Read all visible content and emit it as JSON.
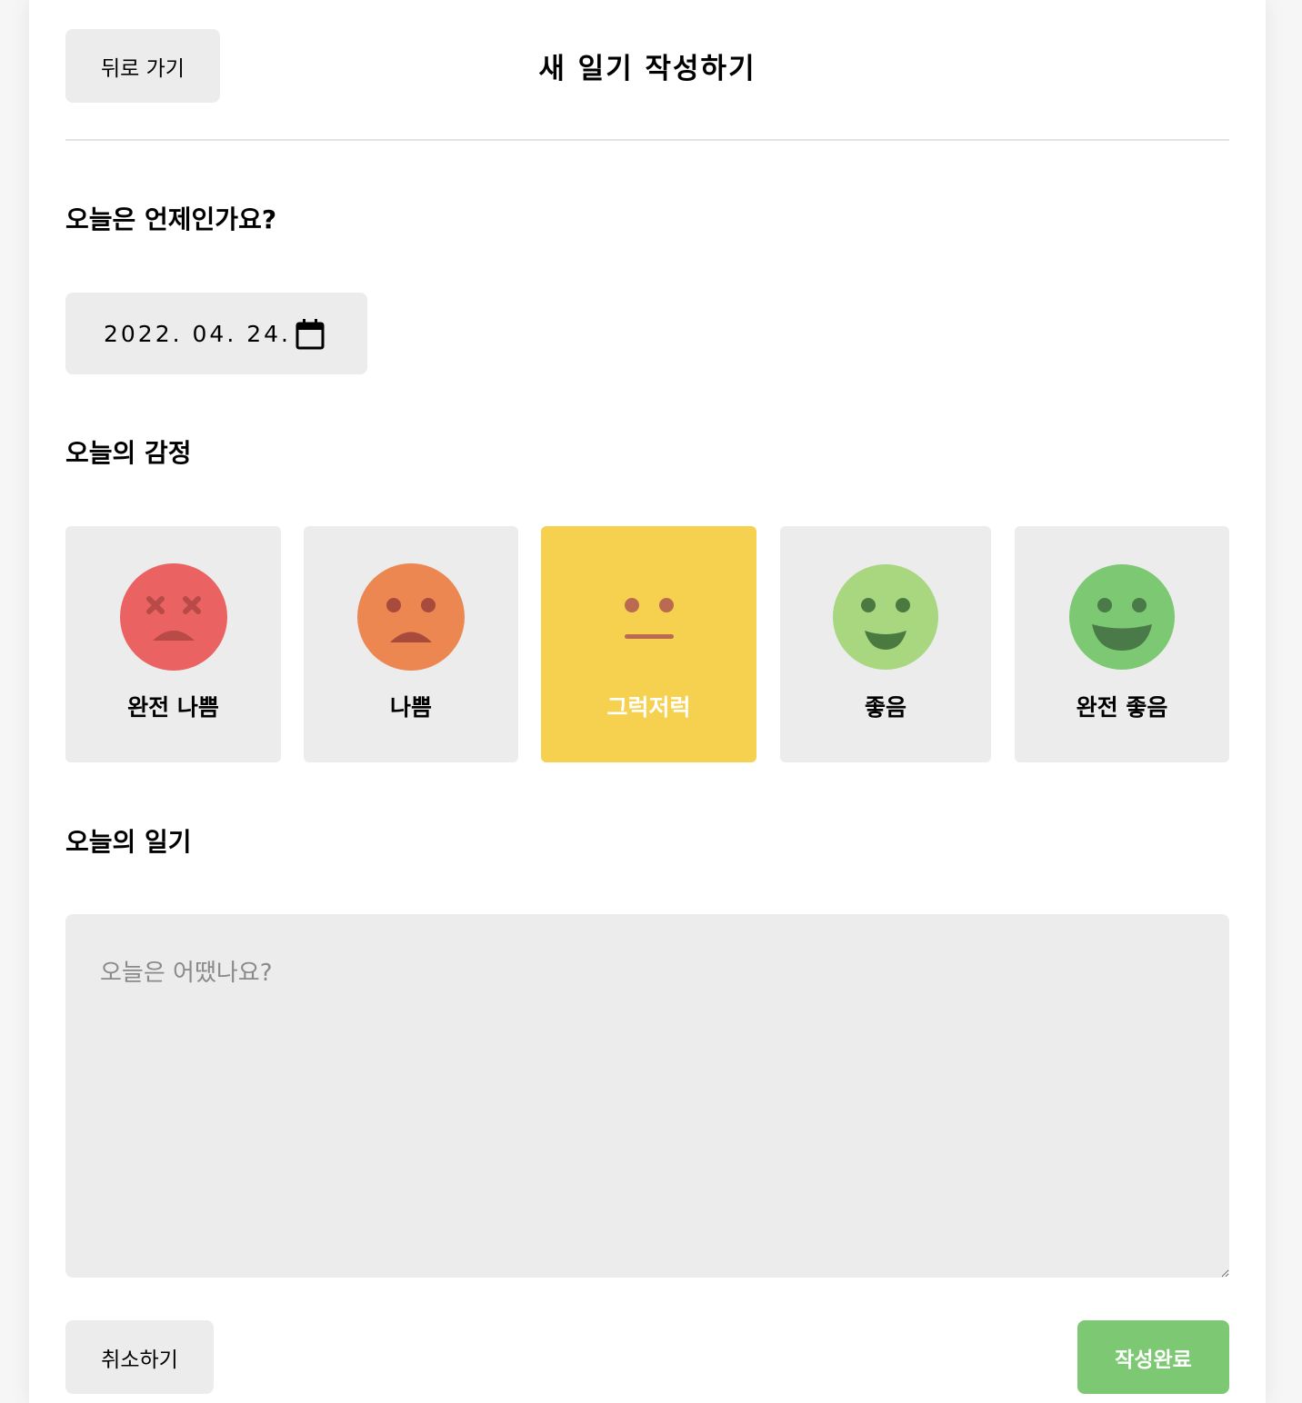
{
  "header": {
    "back_label": "뒤로 가기",
    "title": "새 일기 작성하기"
  },
  "date_section": {
    "title": "오늘은 언제인가요?",
    "value": "2022. 04. 24.",
    "icon": "calendar-icon"
  },
  "emotion_section": {
    "title": "오늘의 감정",
    "items": [
      {
        "label": "완전 나쁨",
        "color": "#ea6262",
        "feature": "#b84a48",
        "selected": false,
        "icon": "very-bad-face-icon"
      },
      {
        "label": "나쁨",
        "color": "#ec8752",
        "feature": "#a84a3c",
        "selected": false,
        "icon": "bad-face-icon"
      },
      {
        "label": "그럭저럭",
        "color": "#f5d14f",
        "feature": "#b96a50",
        "selected": true,
        "icon": "neutral-face-icon"
      },
      {
        "label": "좋음",
        "color": "#a8d780",
        "feature": "#4a7a40",
        "selected": false,
        "icon": "good-face-icon"
      },
      {
        "label": "완전 좋음",
        "color": "#7dc873",
        "feature": "#4a7a47",
        "selected": false,
        "icon": "very-good-face-icon"
      }
    ]
  },
  "diary_section": {
    "title": "오늘의 일기",
    "placeholder": "오늘은 어땠나요?",
    "value": ""
  },
  "footer": {
    "cancel_label": "취소하기",
    "submit_label": "작성완료",
    "submit_color": "#7dc873"
  }
}
